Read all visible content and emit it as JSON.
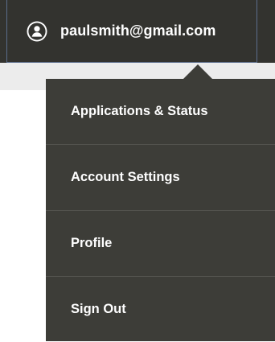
{
  "account": {
    "email": "paulsmith@gmail.com",
    "icon": "user-circle-icon"
  },
  "menu": {
    "items": [
      {
        "label": "Applications & Status"
      },
      {
        "label": "Account Settings"
      },
      {
        "label": "Profile"
      },
      {
        "label": "Sign Out"
      }
    ]
  },
  "colors": {
    "topbar": "#33332f",
    "dropdown": "#3d3d38",
    "divider": "#54544f",
    "button_border": "#5b6d8c",
    "text": "#ffffff",
    "background_strip": "#ececec"
  }
}
